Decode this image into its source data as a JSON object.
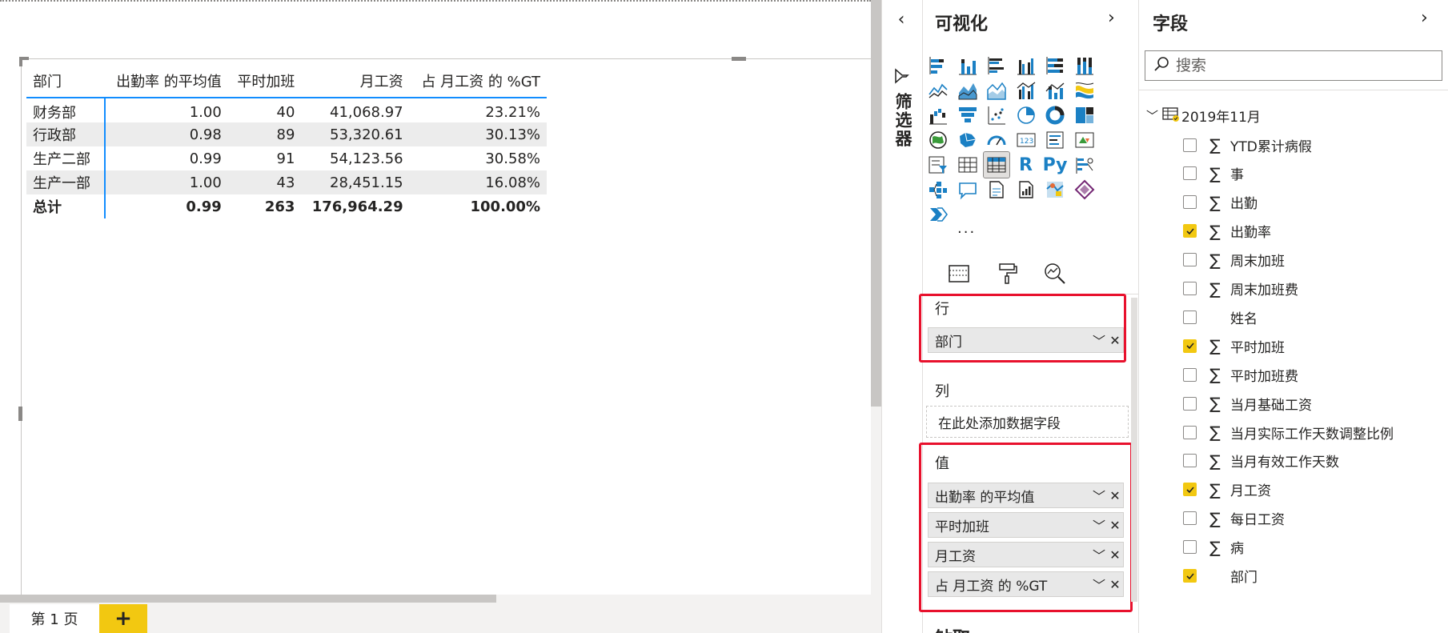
{
  "canvas": {
    "matrix": {
      "headers": [
        "部门",
        "出勤率 的平均值",
        "平时加班",
        "月工资",
        "占 月工资 的 %GT"
      ],
      "rows": [
        {
          "dept": "财务部",
          "attendance": "1.00",
          "overtime": "40",
          "salary": "41,068.97",
          "pct": "23.21%"
        },
        {
          "dept": "行政部",
          "attendance": "0.98",
          "overtime": "89",
          "salary": "53,320.61",
          "pct": "30.13%"
        },
        {
          "dept": "生产二部",
          "attendance": "0.99",
          "overtime": "91",
          "salary": "54,123.56",
          "pct": "30.58%"
        },
        {
          "dept": "生产一部",
          "attendance": "1.00",
          "overtime": "43",
          "salary": "28,451.15",
          "pct": "16.08%"
        }
      ],
      "total": {
        "label": "总计",
        "attendance": "0.99",
        "overtime": "263",
        "salary": "176,964.29",
        "pct": "100.00%"
      }
    },
    "page_tab": "第 1 页",
    "add_page": "+"
  },
  "filters": {
    "collapse_glyph": "‹",
    "label": "筛选器"
  },
  "visualizations": {
    "title": "可视化",
    "chevron": "›",
    "more": "···",
    "icons": [
      "stacked-bar-chart",
      "stacked-column-chart",
      "clustered-bar-chart",
      "clustered-column-chart",
      "100-stacked-bar-chart",
      "100-stacked-column-chart",
      "line-chart",
      "area-chart",
      "stacked-area-chart",
      "line-clustered-column-chart",
      "line-stacked-column-chart",
      "ribbon-chart",
      "waterfall-chart",
      "funnel-chart",
      "scatter-chart",
      "pie-chart",
      "donut-chart",
      "treemap",
      "map",
      "filled-map",
      "gauge",
      "card",
      "multi-row-card",
      "kpi",
      "slicer",
      "table",
      "matrix",
      "r-visual",
      "python-visual",
      "key-influencers",
      "decomposition-tree",
      "qa",
      "smart-narrative",
      "paginated-report",
      "arcgis-map",
      "power-apps",
      "power-automate"
    ],
    "selected_icon": "matrix",
    "rows_title": "行",
    "rows_fields": [
      "部门"
    ],
    "columns_title": "列",
    "columns_placeholder": "在此处添加数据字段",
    "values_title": "值",
    "values_fields": [
      "出勤率 的平均值",
      "平时加班",
      "月工资",
      "占 月工资 的 %GT"
    ],
    "next_section_title": "钻取"
  },
  "fields": {
    "title": "字段",
    "chevron": "›",
    "search_placeholder": "搜索",
    "table_name": "2019年11月",
    "items": [
      {
        "name": "YTD累计病假",
        "sigma": true,
        "checked": false
      },
      {
        "name": "事",
        "sigma": true,
        "checked": false
      },
      {
        "name": "出勤",
        "sigma": true,
        "checked": false
      },
      {
        "name": "出勤率",
        "sigma": true,
        "checked": true
      },
      {
        "name": "周末加班",
        "sigma": true,
        "checked": false
      },
      {
        "name": "周末加班费",
        "sigma": true,
        "checked": false
      },
      {
        "name": "姓名",
        "sigma": false,
        "checked": false
      },
      {
        "name": "平时加班",
        "sigma": true,
        "checked": true
      },
      {
        "name": "平时加班费",
        "sigma": true,
        "checked": false
      },
      {
        "name": "当月基础工资",
        "sigma": true,
        "checked": false
      },
      {
        "name": "当月实际工作天数调整比例",
        "sigma": true,
        "checked": false
      },
      {
        "name": "当月有效工作天数",
        "sigma": true,
        "checked": false
      },
      {
        "name": "月工资",
        "sigma": true,
        "checked": true
      },
      {
        "name": "每日工资",
        "sigma": true,
        "checked": false
      },
      {
        "name": "病",
        "sigma": true,
        "checked": false
      },
      {
        "name": "部门",
        "sigma": false,
        "checked": true
      }
    ]
  },
  "colors": {
    "accent_blue": "#118dff",
    "highlight_red": "#e8112d",
    "check_yellow": "#f2c811",
    "icon_blue": "#1b80c4"
  }
}
